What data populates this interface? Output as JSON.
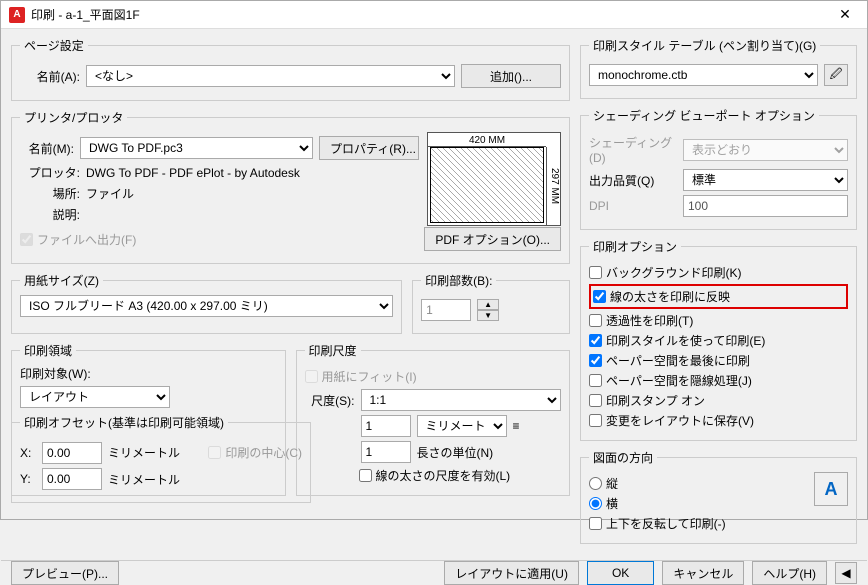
{
  "window_title": "印刷 - a-1_平面図1F",
  "page": {
    "legend": "ページ設定",
    "name_label": "名前(A):",
    "name_value": "<なし>",
    "add_btn": "追加()..."
  },
  "printer": {
    "legend": "プリンタ/プロッタ",
    "name_label": "名前(M):",
    "name_value": "DWG To PDF.pc3",
    "properties_btn": "プロパティ(R)...",
    "plotter_label": "プロッタ:",
    "plotter_value": "DWG To PDF - PDF ePlot - by Autodesk",
    "where_label": "場所:",
    "where_value": "ファイル",
    "desc_label": "説明:",
    "desc_value": "",
    "to_file": "ファイルへ出力(F)",
    "pdf_options": "PDF オプション(O)...",
    "dim_top": "420 MM",
    "dim_right": "297 MM"
  },
  "paper": {
    "legend": "用紙サイズ(Z)",
    "size": "ISO フルブリード A3 (420.00 x 297.00 ミリ)",
    "copies_label": "印刷部数(B):",
    "copies": "1"
  },
  "area": {
    "legend": "印刷領域",
    "target_label": "印刷対象(W):",
    "target": "レイアウト"
  },
  "scale": {
    "legend": "印刷尺度",
    "fit": "用紙にフィット(I)",
    "ratio_label": "尺度(S):",
    "ratio": "1:1",
    "mm_val": "1",
    "mm_unit": "ミリメートル",
    "len_val": "1",
    "len_label": "長さの単位(N)",
    "lineweight": "線の太さの尺度を有効(L)"
  },
  "offset": {
    "legend": "印刷オフセット(基準は印刷可能領域)",
    "x_label": "X:",
    "x_val": "0.00",
    "y_label": "Y:",
    "y_val": "0.00",
    "unit": "ミリメートル",
    "center": "印刷の中心(C)"
  },
  "style": {
    "legend": "印刷スタイル テーブル (ペン割り当て)(G)",
    "value": "monochrome.ctb"
  },
  "shading": {
    "legend": "シェーディング ビューポート オプション",
    "shading_label": "シェーディング(D)",
    "shading_value": "表示どおり",
    "quality_label": "出力品質(Q)",
    "quality_value": "標準",
    "dpi_label": "DPI",
    "dpi_value": "100"
  },
  "options": {
    "legend": "印刷オプション",
    "bg": "バックグラウンド印刷(K)",
    "lw": "線の太さを印刷に反映",
    "trans": "透過性を印刷(T)",
    "use_style": "印刷スタイルを使って印刷(E)",
    "paper_last": "ペーパー空間を最後に印刷",
    "hidden": "ペーパー空間を隠線処理(J)",
    "stamp": "印刷スタンプ オン",
    "save_layout": "変更をレイアウトに保存(V)"
  },
  "orient": {
    "legend": "図面の方向",
    "portrait": "縦",
    "landscape": "横",
    "upside": "上下を反転して印刷(-)"
  },
  "footer": {
    "preview": "プレビュー(P)...",
    "apply": "レイアウトに適用(U)",
    "ok": "OK",
    "cancel": "キャンセル",
    "help": "ヘルプ(H)"
  }
}
